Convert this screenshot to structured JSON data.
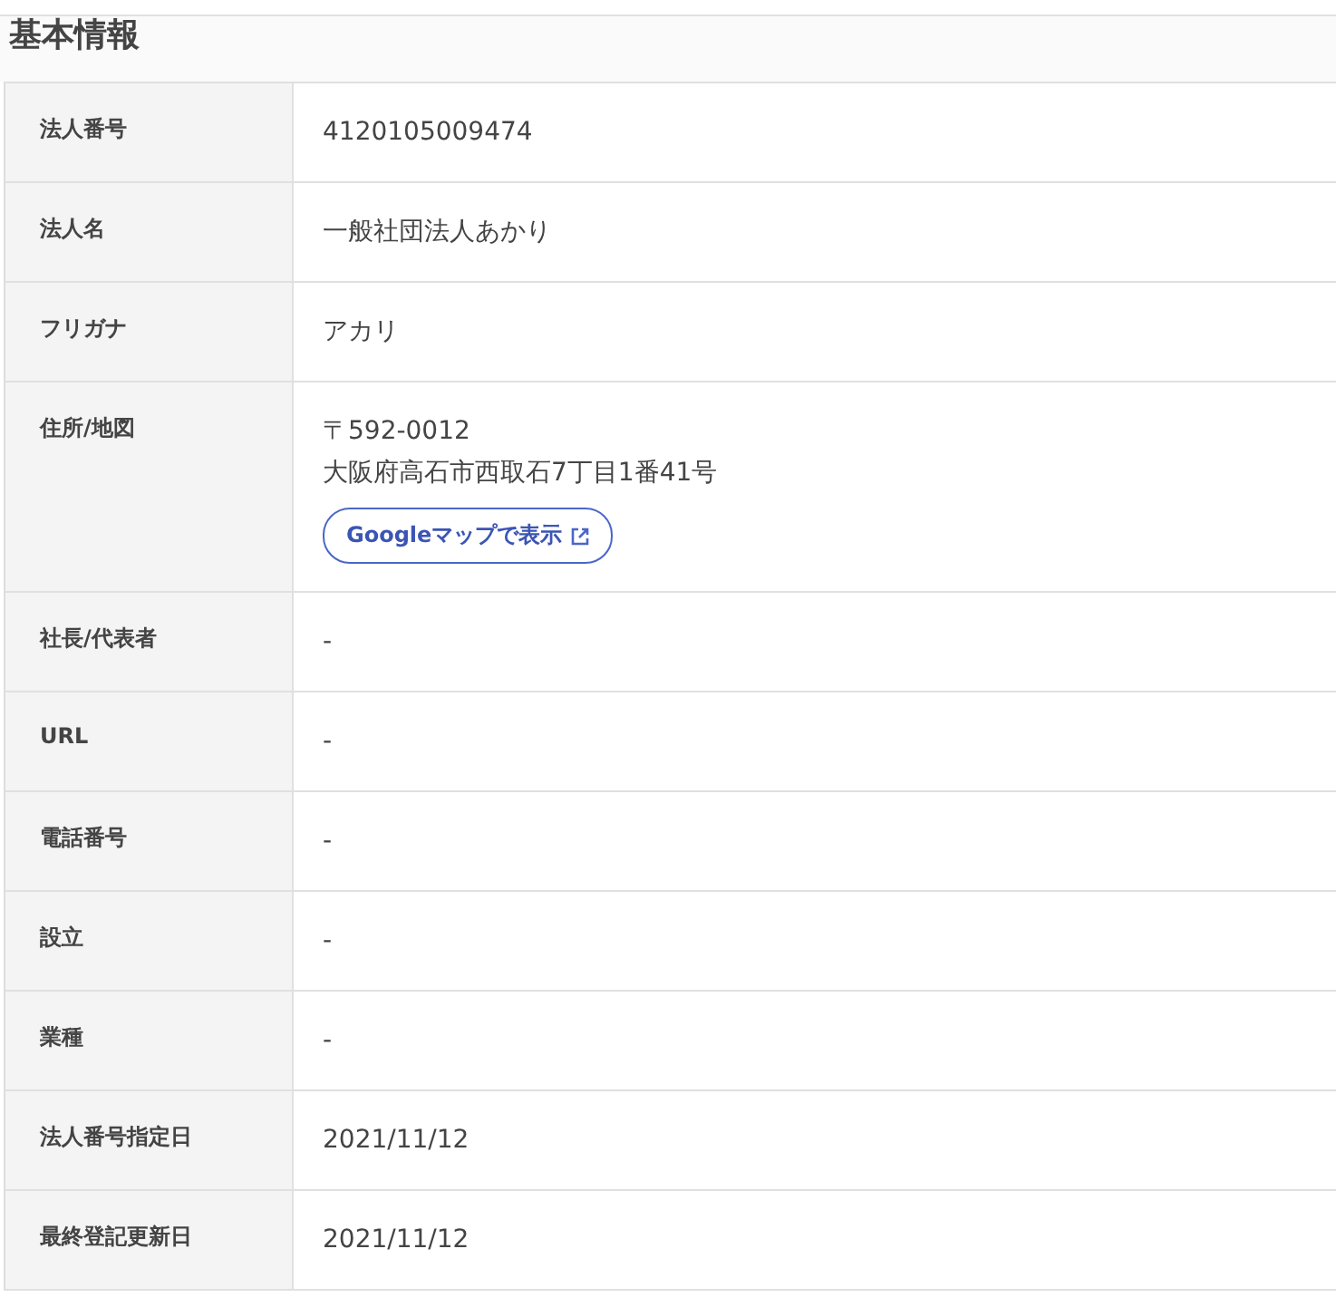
{
  "title": "基本情報",
  "rows": [
    {
      "label": "法人番号",
      "lines": [
        "4120105009474"
      ]
    },
    {
      "label": "法人名",
      "lines": [
        "一般社団法人あかり"
      ]
    },
    {
      "label": "フリガナ",
      "lines": [
        "アカリ"
      ]
    },
    {
      "label": "住所/地図",
      "lines": [
        "〒592-0012",
        "大阪府高石市西取石7丁目1番41号"
      ],
      "map_link": "Googleマップで表示"
    },
    {
      "label": "社長/代表者",
      "lines": [
        "-"
      ]
    },
    {
      "label": "URL",
      "lines": [
        "-"
      ]
    },
    {
      "label": "電話番号",
      "lines": [
        "-"
      ]
    },
    {
      "label": "設立",
      "lines": [
        "-"
      ]
    },
    {
      "label": "業種",
      "lines": [
        "-"
      ]
    },
    {
      "label": "法人番号指定日",
      "lines": [
        "2021/11/12"
      ]
    },
    {
      "label": "最終登記更新日",
      "lines": [
        "2021/11/12"
      ]
    }
  ]
}
